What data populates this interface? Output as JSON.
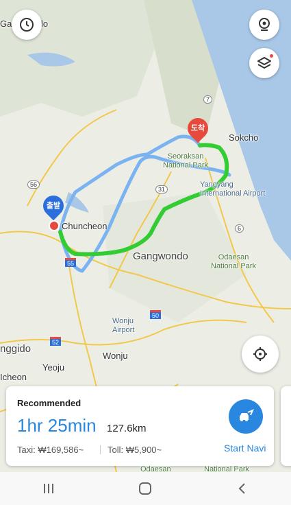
{
  "top_buttons": {
    "history_icon": "clock-icon",
    "camera_icon": "camera-icon",
    "layers_icon": "layers-icon"
  },
  "map": {
    "labels": {
      "gangwondo_top": "Gangwondo",
      "sokcho": "Sokcho",
      "seoraksan": "Seoraksan\nNational Park",
      "yangyang": "Yangyang\nInternational Airport",
      "chuncheon": "Chuncheon",
      "gangwondo": "Gangwondo",
      "odaesan": "Odaesan\nNational Park",
      "wonju_airport": "Wonju\nAirport",
      "wonju": "Wonju",
      "gyeonggido": "nggido",
      "yeoju": "Yeoju",
      "icheon": "Icheon",
      "odaesan_bottom": "Odaesan",
      "national_park_bottom": "National Park"
    },
    "road_numbers": [
      "7",
      "56",
      "31",
      "6",
      "55",
      "50",
      "52"
    ],
    "origin_pin": "출발",
    "destination_pin": "도착"
  },
  "colors": {
    "route_main": "#33cc33",
    "route_alt": "#7ab3f0",
    "accent": "#2a87e0",
    "dest_pin": "#e64a3c",
    "origin_pin": "#2a6fdb"
  },
  "route_card": {
    "badge": "Recommended",
    "duration": "1hr 25min",
    "distance": "127.6km",
    "taxi": "Taxi: ₩169,586~",
    "toll": "Toll: ₩5,900~",
    "start_label": "Start Navi"
  },
  "nav_bar": {
    "recent_icon": "recent-apps-icon",
    "home_icon": "home-icon",
    "back_icon": "back-icon"
  }
}
